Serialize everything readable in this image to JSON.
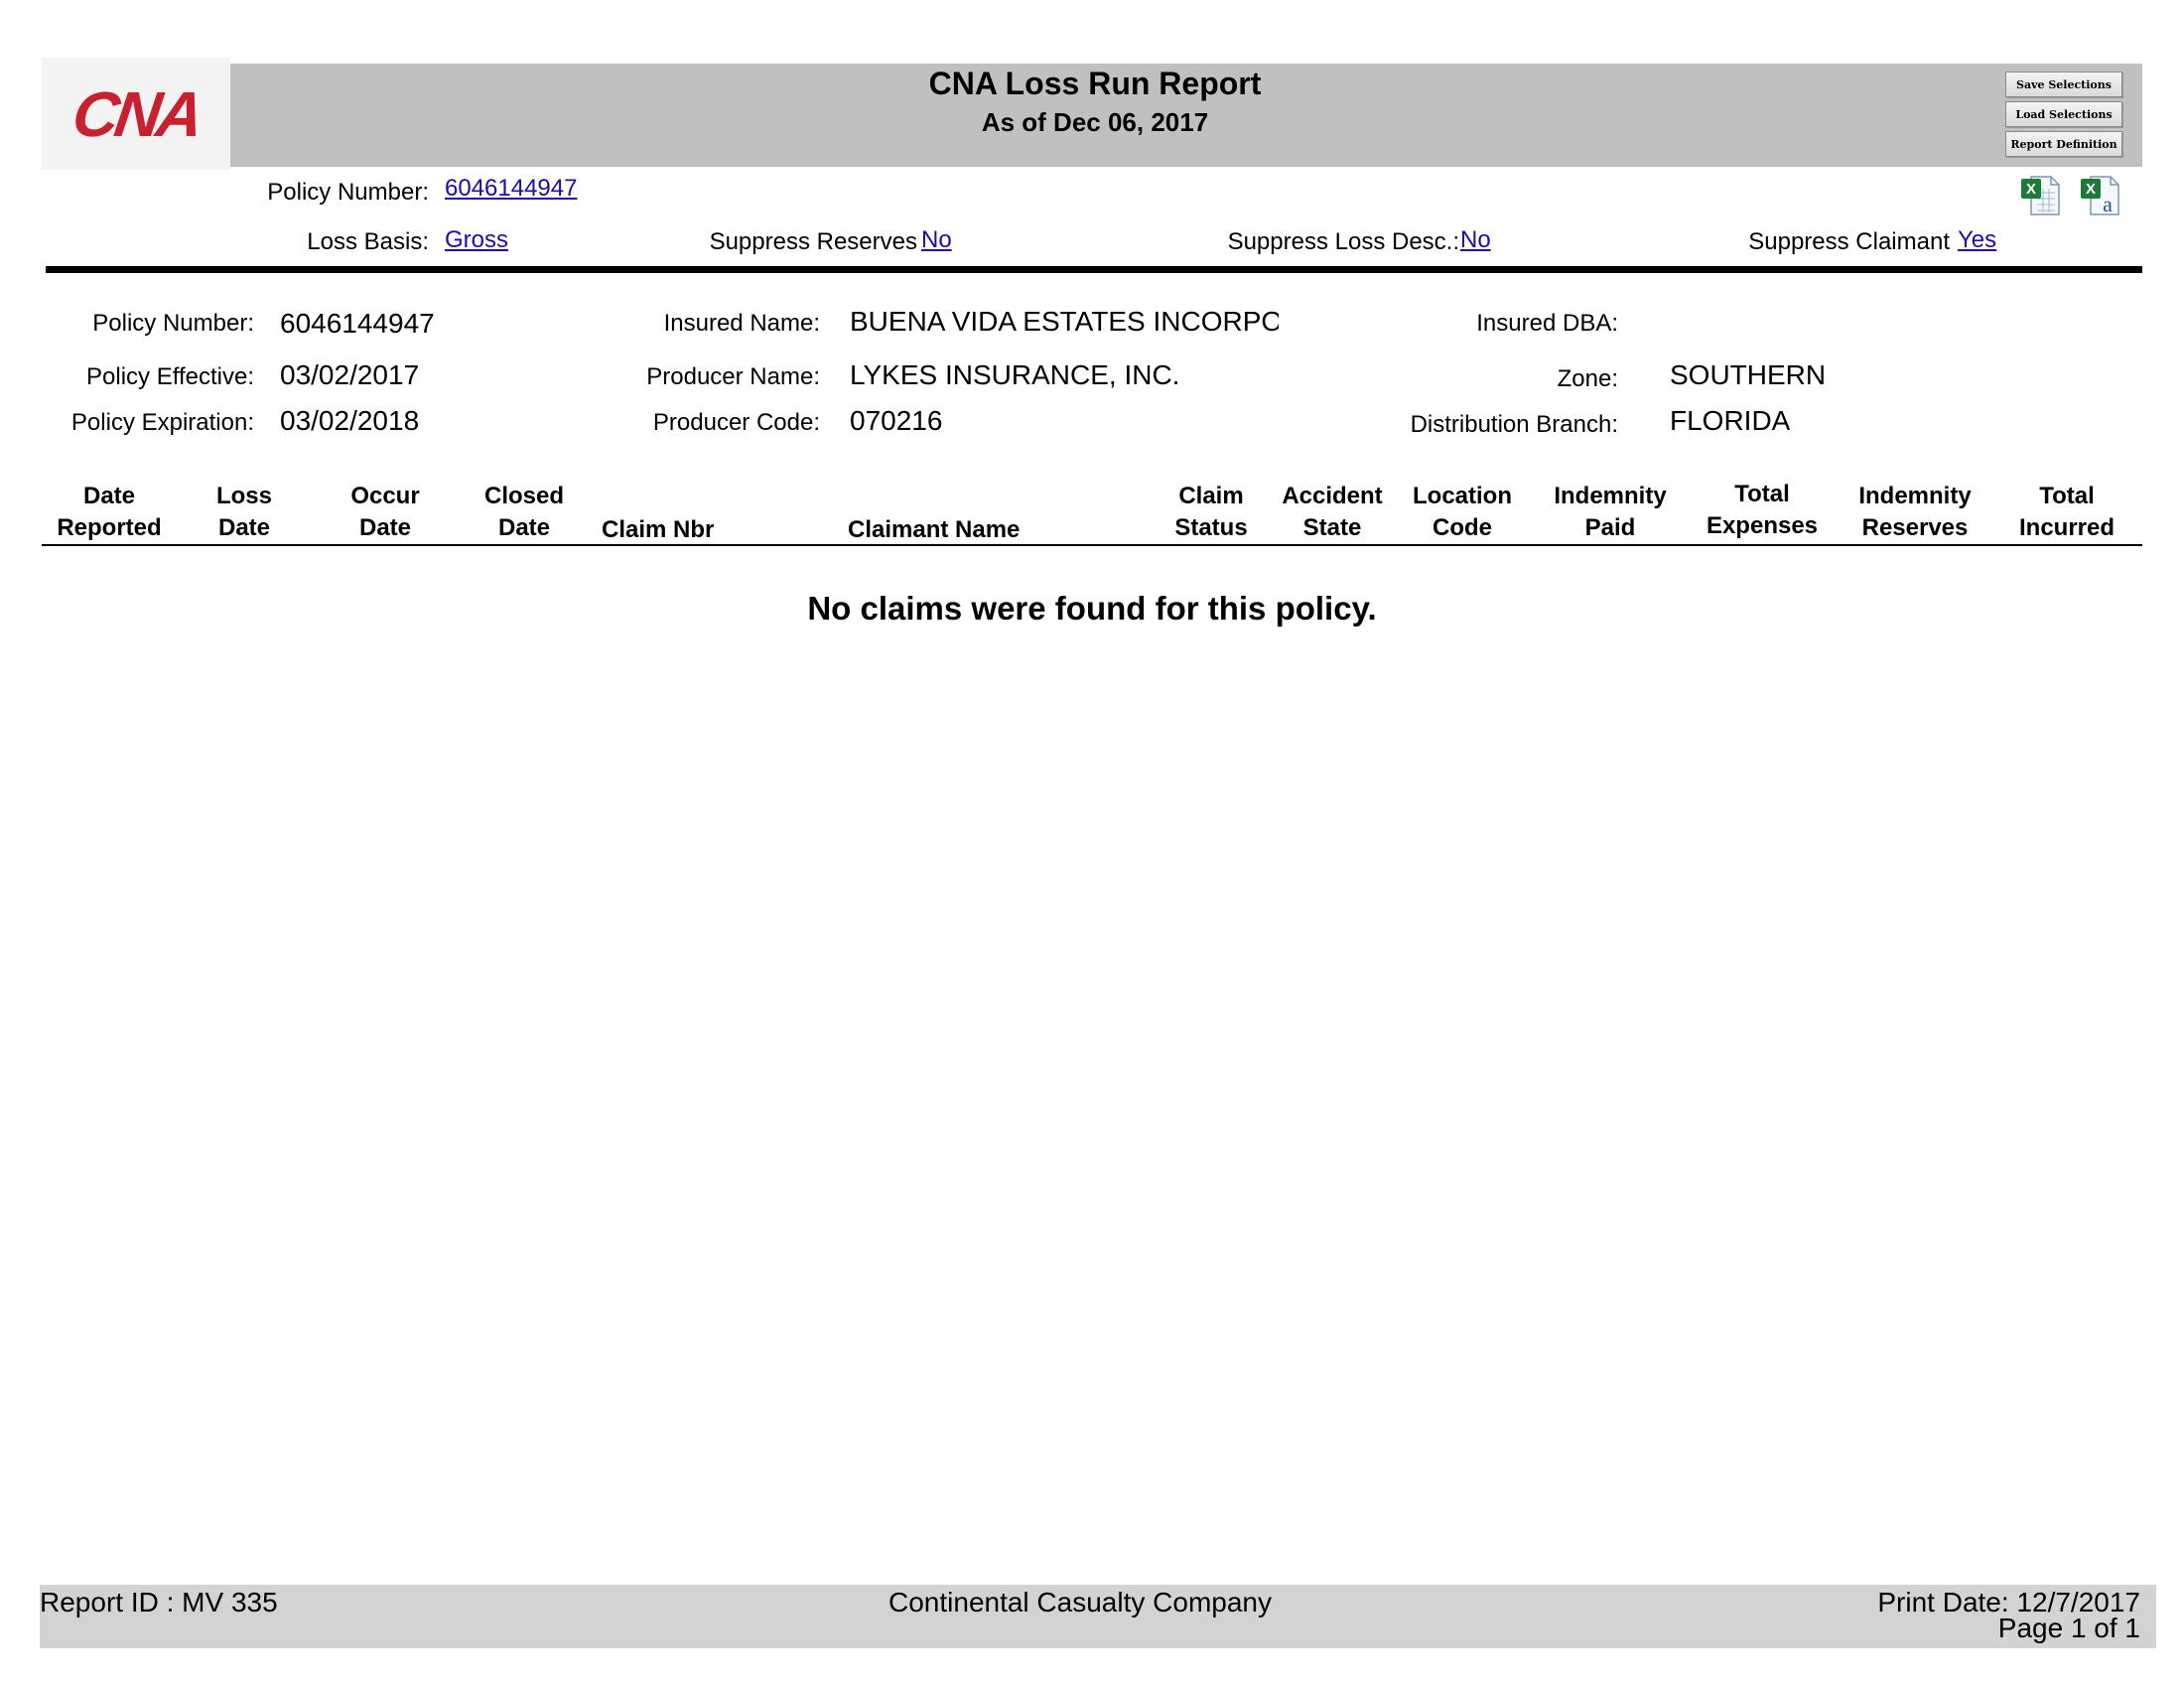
{
  "header": {
    "logo_text": "CNA",
    "title": "CNA Loss Run Report",
    "subtitle": "As of Dec 06, 2017",
    "buttons": {
      "save": "Save Selections",
      "load": "Load Selections",
      "definition": "Report Definition"
    },
    "brand_color": "#c8202f"
  },
  "params": {
    "policy_number_label": "Policy Number:",
    "policy_number_link": "6046144947",
    "loss_basis_label": "Loss Basis:",
    "loss_basis_link": "Gross",
    "suppress_reserves_label": "Suppress Reserves",
    "suppress_reserves_link": "No",
    "suppress_loss_desc_label": "Suppress Loss Desc.:",
    "suppress_loss_desc_link": "No",
    "suppress_claimant_label": "Suppress Claimant",
    "suppress_claimant_link": "Yes",
    "export_icons": [
      "excel-export-icon",
      "excel-data-export-icon"
    ]
  },
  "info": {
    "policy_number_label": "Policy Number:",
    "policy_number": "6046144947",
    "policy_effective_label": "Policy Effective:",
    "policy_effective": "03/02/2017",
    "policy_expiration_label": "Policy Expiration:",
    "policy_expiration": "03/02/2018",
    "insured_name_label": "Insured Name:",
    "insured_name": "BUENA VIDA ESTATES INCORPORATED",
    "producer_name_label": "Producer Name:",
    "producer_name": "LYKES INSURANCE, INC.",
    "producer_code_label": "Producer Code:",
    "producer_code": "070216",
    "insured_dba_label": "Insured DBA:",
    "zone_label": "Zone:",
    "zone": "SOUTHERN",
    "distribution_branch_label": "Distribution Branch:",
    "distribution_branch": "FLORIDA"
  },
  "table": {
    "columns": [
      {
        "line1": "Date",
        "line2": "Reported"
      },
      {
        "line1": "Loss",
        "line2": "Date"
      },
      {
        "line1": "Occur",
        "line2": "Date"
      },
      {
        "line1": "Closed",
        "line2": "Date"
      },
      {
        "line1": "",
        "line2": "Claim Nbr"
      },
      {
        "line1": "",
        "line2": "Claimant Name"
      },
      {
        "line1": "Claim",
        "line2": "Status"
      },
      {
        "line1": "Accident",
        "line2": "State"
      },
      {
        "line1": "Location",
        "line2": "Code"
      },
      {
        "line1": "Indemnity",
        "line2": "Paid"
      },
      {
        "line1": "Total",
        "line2": "Expenses"
      },
      {
        "line1": "Indemnity",
        "line2": "Reserves"
      },
      {
        "line1": "Total",
        "line2": "Incurred"
      }
    ],
    "empty_message": "No claims were found for this policy."
  },
  "footer": {
    "report_id": "Report ID : MV 335",
    "company": "Continental Casualty Company",
    "print_date": "Print Date: 12/7/2017",
    "page": "Page 1 of 1"
  }
}
